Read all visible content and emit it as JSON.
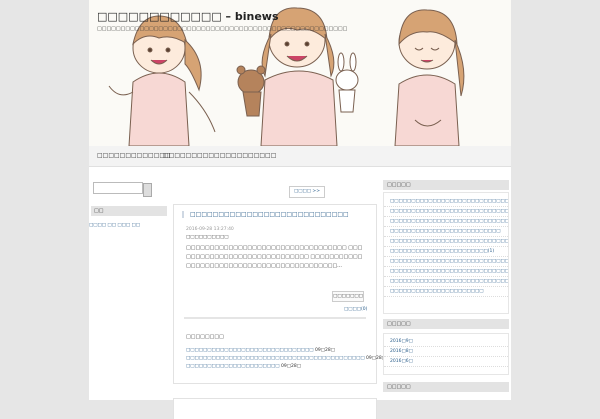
{
  "site": {
    "title": "□□□□□□□□□□□□ – binews",
    "description": "□□□□□□□□□□□□□□□□□□□□□□□□□□□□□□□□□□□□□□□□□□□□□□□□□□□□□"
  },
  "nav": {
    "items": [
      "□□□□□□□□□□□□□",
      "□□□□□□□□□□□□□□□□□□□□"
    ]
  },
  "left": {
    "widget_title": "□□",
    "link": "□□□□ □□ □□□ □□"
  },
  "main": {
    "next_label": "□□□□ >>",
    "post": {
      "title": "□□□□□□□□□□□□□□□□□□□□□□□□□□□□",
      "meta": "2016-09-28 13:27:40",
      "category": "□□□□□□□□□□",
      "body": "□□□□□□□□□□□□□□□□□□□□□□□□□□□□□□□□□□ □□□□□□□□□□□□□□□□□□□□□□□□□□□□□ □□□□□□□□□□□□□□□□□□□□□□□□□□□□□□□□□□□□□□□□□□□...",
      "more_label": "□□□□□□□",
      "comments_label": "□□□□(0)",
      "related_title": "□□□□□□□□",
      "related": [
        {
          "text": "□□□□□□□□□□□□□□□□□□□□□□□□□□□□□□",
          "date": "09□28□"
        },
        {
          "text": "□□□□□□□□□□□□□□□□□□□□□□□□□□□□□□□□□□□□□□□□□□",
          "date": "09□28□"
        },
        {
          "text": "□□□□□□□□□□□□□□□□□□□□□□",
          "date": "09□28□"
        }
      ]
    }
  },
  "right": {
    "recent_title": "□□□□□",
    "recent": [
      "□□□□□□□□□□□□□□□□□□□□□□□□□□□□□",
      "□□□□□□□□□□□□□□□□□□□□□□□□□□□□□□",
      "□□□□□□□□□□□□□□□□□□□□□□□□□□□□□□□□□□□□□□□",
      "□□□□□□□□□□□□□□□□□□□□□□□□□□",
      "□□□□□□□□□□□□□□□□□□□□□□□□□□□□□□□□",
      "□□□□□□□□□□□□□□□□□□□□□□□(1)",
      "□□□□□□□□□□□□□□□□□□□□□□□□□□□□",
      "□□□□□□□□□□□□□□□□□□□□□□□□□□□□□□□□□□□□□□",
      "□□□□□□□□□□□□□□□□□□□□□□□□□□□□□□□□□□",
      "□□□□□□□□□□□□□□□□□□□□□□"
    ],
    "archive_title": "□□□□□",
    "archive": [
      "2016□9□",
      "2016□8□",
      "2016□6□"
    ],
    "category_title": "□□□□□"
  },
  "colors": {
    "link": "#2a5d8a",
    "background": "#e6e6e6",
    "header_bg": "#fbfaf6"
  }
}
